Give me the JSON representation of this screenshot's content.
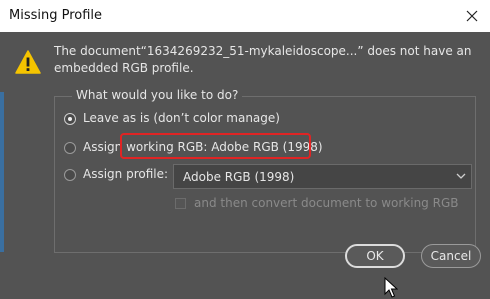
{
  "window": {
    "title": "Missing Profile",
    "close_icon": "close-icon"
  },
  "message": {
    "icon": "warning-icon",
    "text": "The document“1634269232_51-mykaleidoscope...” does not have an embedded RGB profile."
  },
  "group": {
    "title": "What would you like to do?",
    "options": [
      {
        "label": "Leave as is (don’t color manage)",
        "selected": true
      },
      {
        "label": "Assign working RGB:  Adobe RGB (1998)",
        "selected": false
      },
      {
        "label": "Assign profile:",
        "selected": false
      }
    ],
    "profile_select": {
      "value": "Adobe RGB (1998)"
    },
    "convert_checkbox": {
      "label": "and then convert document to working RGB",
      "checked": false,
      "disabled": true
    }
  },
  "buttons": {
    "ok": "OK",
    "cancel": "Cancel"
  },
  "colors": {
    "dialog_bg": "#535353",
    "highlight": "#e02424",
    "warning": "#f5c400"
  }
}
